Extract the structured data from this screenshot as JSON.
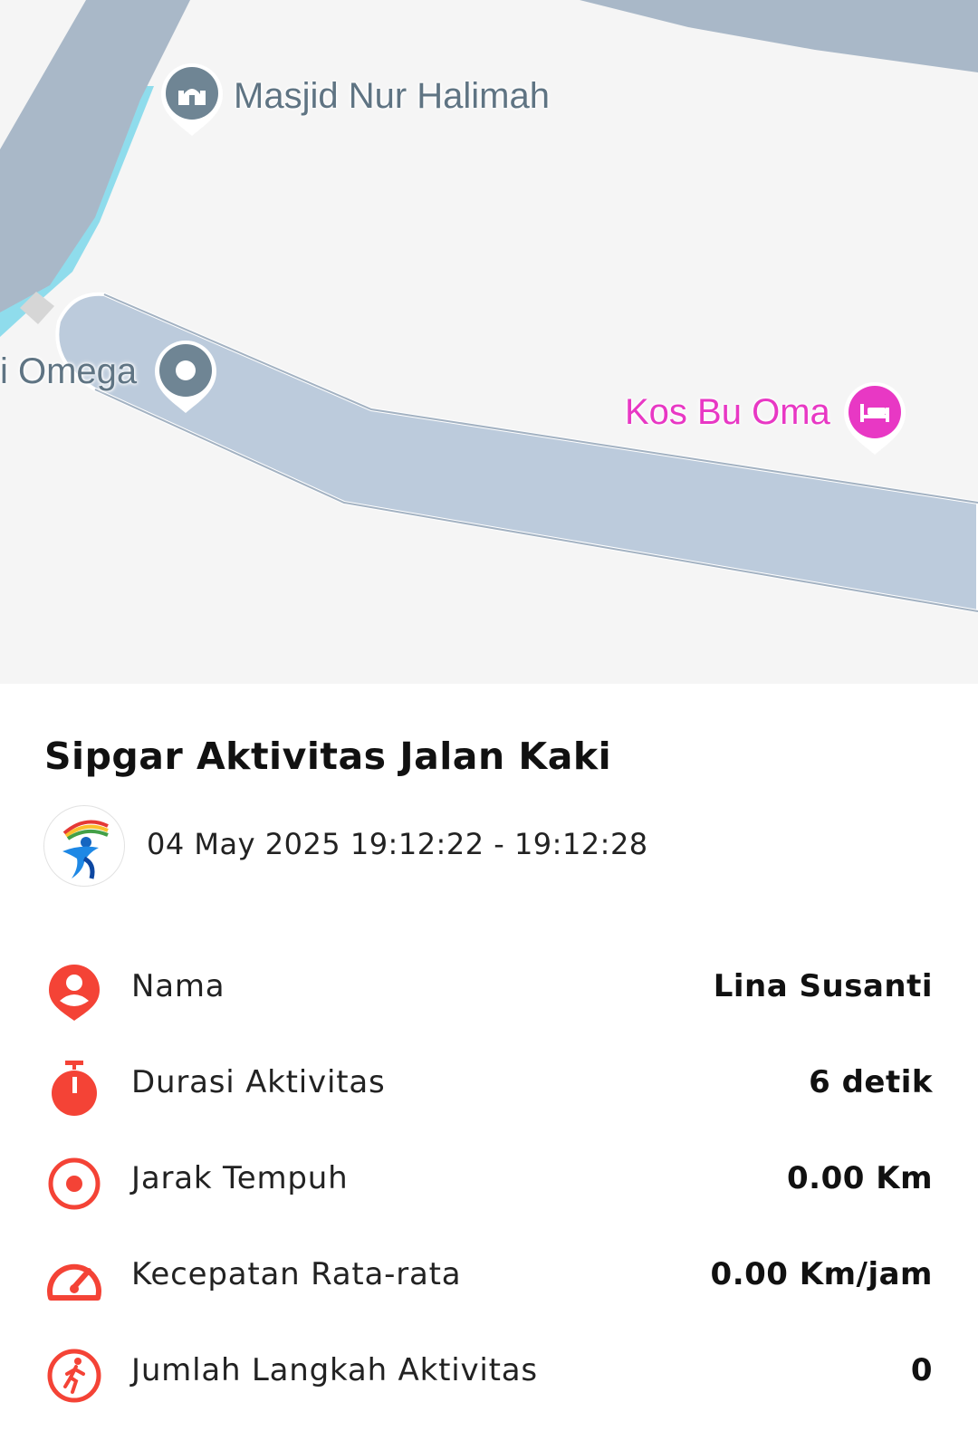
{
  "map": {
    "poi_labels": {
      "masjid": "Masjid Nur Halimah",
      "omega": "i Omega",
      "kos": "Kos Bu Oma"
    },
    "icons": {
      "masjid": "mosque-pin-icon",
      "omega": "place-pin-icon",
      "kos": "hotel-bed-pin-icon"
    },
    "colors": {
      "background": "#f5f5f5",
      "road": "#a9b8c8",
      "water": "#8fdcec",
      "poi_grey": "#6f8594",
      "poi_pink": "#e838c4"
    }
  },
  "activity": {
    "title": "Sipgar Aktivitas Jalan Kaki",
    "datetime": "04 May 2025 19:12:22 - 19:12:28",
    "logo_icon": "running-person-logo-icon",
    "accent_color": "#f44336",
    "stats": [
      {
        "label": "Nama",
        "value": "Lina Susanti",
        "icon": "person-pin-icon"
      },
      {
        "label": "Durasi Aktivitas",
        "value": "6 detik",
        "icon": "stopwatch-icon"
      },
      {
        "label": "Jarak Tempuh",
        "value": "0.00 Km",
        "icon": "target-icon"
      },
      {
        "label": "Kecepatan Rata-rata",
        "value": "0.00 Km/jam",
        "icon": "speedometer-icon"
      },
      {
        "label": "Jumlah Langkah Aktivitas",
        "value": "0",
        "icon": "walking-person-icon"
      }
    ]
  }
}
